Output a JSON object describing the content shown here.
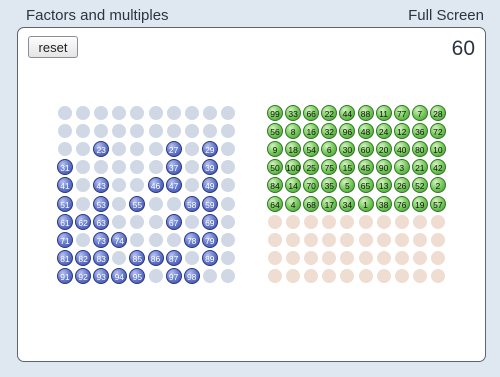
{
  "header": {
    "title": "Factors and multiples",
    "fullscreen_label": "Full Screen"
  },
  "toolbar": {
    "reset_label": "reset"
  },
  "score": "60",
  "board": {
    "rows": 10,
    "cols": 10,
    "filled": [
      "23",
      "27",
      "29",
      "31",
      "37",
      "39",
      "41",
      "43",
      "46",
      "47",
      "49",
      "51",
      "53",
      "55",
      "58",
      "59",
      "61",
      "62",
      "63",
      "67",
      "69",
      "71",
      "73",
      "74",
      "78",
      "79",
      "81",
      "82",
      "83",
      "85",
      "86",
      "87",
      "89",
      "91",
      "92",
      "93",
      "94",
      "95",
      "97",
      "98"
    ]
  },
  "tray": {
    "rows": 10,
    "cols": 10,
    "balls": [
      [
        "99",
        "33",
        "66",
        "22",
        "44",
        "88",
        "11",
        "77",
        "7",
        "28"
      ],
      [
        "56",
        "8",
        "16",
        "32",
        "96",
        "48",
        "24",
        "12",
        "36",
        "72"
      ],
      [
        "9",
        "18",
        "54",
        "6",
        "30",
        "60",
        "20",
        "40",
        "80",
        "10"
      ],
      [
        "50",
        "100",
        "25",
        "75",
        "15",
        "45",
        "90",
        "3",
        "21",
        "42"
      ],
      [
        "84",
        "14",
        "70",
        "35",
        "5",
        "65",
        "13",
        "26",
        "52",
        "2"
      ],
      [
        "64",
        "4",
        "68",
        "17",
        "34",
        "1",
        "38",
        "76",
        "19",
        "57"
      ]
    ]
  }
}
